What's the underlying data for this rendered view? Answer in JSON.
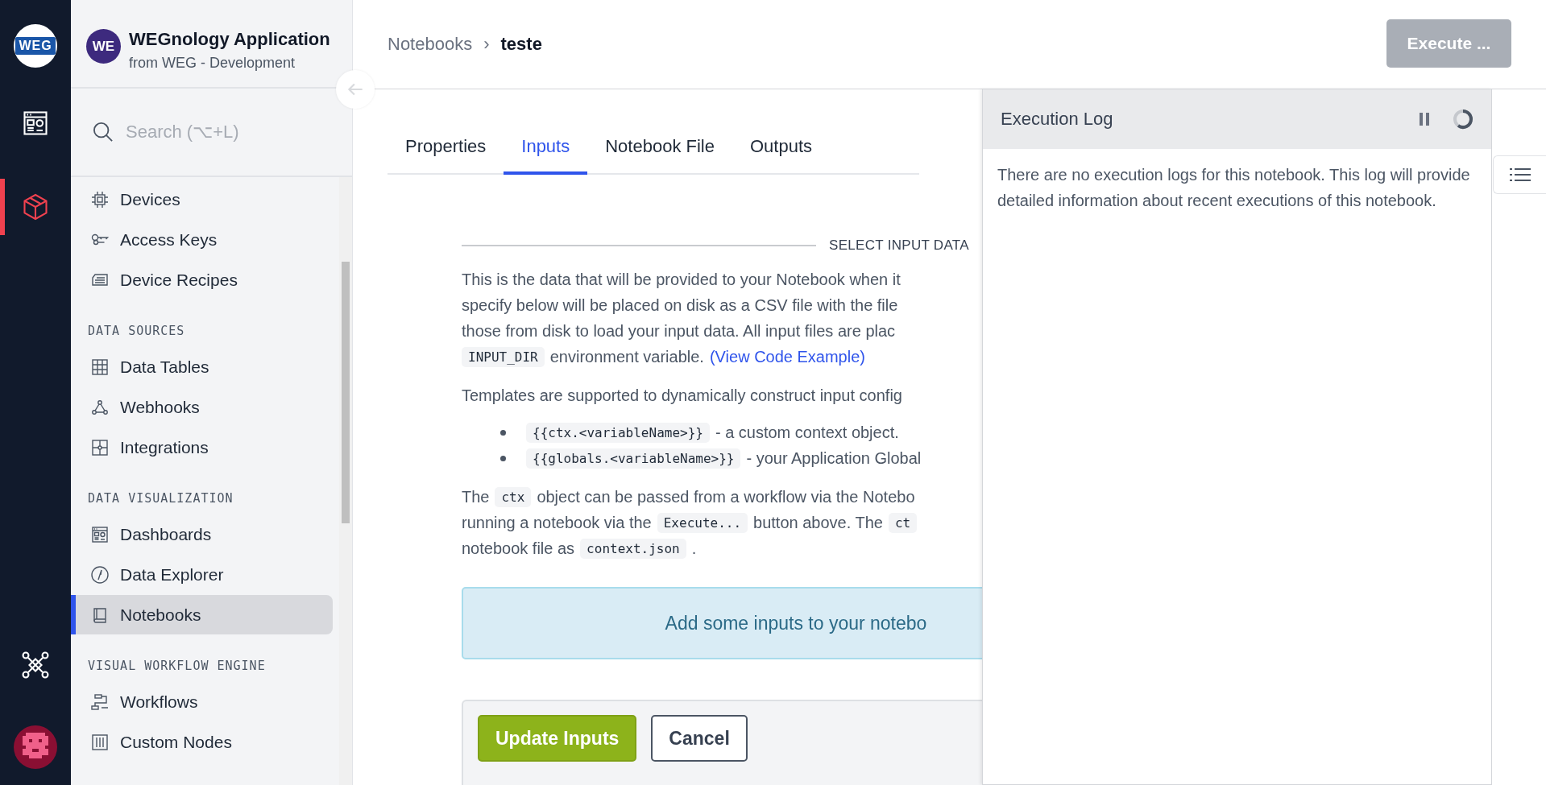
{
  "rail": {
    "logo": "WEG",
    "items": [
      {
        "kind": "dashboard",
        "selected": false
      },
      {
        "kind": "cube",
        "selected": true
      }
    ],
    "bottom_items": [
      {
        "kind": "network",
        "selected": false
      }
    ]
  },
  "app": {
    "avatar": "WE",
    "name": "WEGnology Application",
    "subtitle": "from WEG - Development"
  },
  "search": {
    "placeholder": "Search (⌥+L)"
  },
  "nav": [
    {
      "items": [
        {
          "label": "Devices",
          "kind": "chip",
          "selected": false
        },
        {
          "label": "Access Keys",
          "kind": "keys",
          "selected": false
        },
        {
          "label": "Device Recipes",
          "kind": "recipe",
          "selected": false
        }
      ]
    },
    {
      "title": "DATA SOURCES",
      "items": [
        {
          "label": "Data Tables",
          "kind": "grid",
          "selected": false
        },
        {
          "label": "Webhooks",
          "kind": "webhook",
          "selected": false
        },
        {
          "label": "Integrations",
          "kind": "puzzle",
          "selected": false
        }
      ]
    },
    {
      "title": "DATA VISUALIZATION",
      "items": [
        {
          "label": "Dashboards",
          "kind": "dashboard",
          "selected": false
        },
        {
          "label": "Data Explorer",
          "kind": "compass",
          "selected": false
        },
        {
          "label": "Notebooks",
          "kind": "book",
          "selected": true
        }
      ]
    },
    {
      "title": "VISUAL WORKFLOW ENGINE",
      "items": [
        {
          "label": "Workflows",
          "kind": "workflow",
          "selected": false
        },
        {
          "label": "Custom Nodes",
          "kind": "sliders",
          "selected": false
        }
      ]
    }
  ],
  "breadcrumb": {
    "parent": "Notebooks",
    "separator": "›",
    "current": "teste"
  },
  "execute_button": {
    "label": "Execute ...",
    "disabled": true
  },
  "tabs": [
    {
      "label": "Properties",
      "selected": false
    },
    {
      "label": "Inputs",
      "selected": true
    },
    {
      "label": "Notebook File",
      "selected": false
    },
    {
      "label": "Outputs",
      "selected": false
    }
  ],
  "section_title": "SELECT INPUT DATA",
  "paragraphs": [
    {
      "lines": [
        [
          {
            "kind": "text",
            "text": "This is the data that will be provided to your Notebook when it"
          }
        ],
        [
          {
            "kind": "text",
            "text": "specify below will be placed on disk as a CSV file with the file"
          }
        ],
        [
          {
            "kind": "text",
            "text": "those from disk to load your input data. All input files are plac"
          }
        ],
        [
          {
            "kind": "code",
            "text": "INPUT_DIR"
          },
          {
            "kind": "text",
            "text": "environment variable."
          },
          {
            "kind": "link",
            "text": "(View Code Example)"
          }
        ]
      ]
    },
    {
      "lines": [
        [
          {
            "kind": "text",
            "text": "Templates are supported to dynamically construct input config"
          }
        ]
      ]
    },
    {
      "bullets": [
        [
          {
            "kind": "code",
            "text": "{{ctx.<variableName>}}"
          },
          {
            "kind": "text",
            "text": "- a custom context object."
          }
        ],
        [
          {
            "kind": "code",
            "text": "{{globals.<variableName>}}"
          },
          {
            "kind": "text",
            "text": "- your Application Global"
          }
        ]
      ]
    },
    {
      "lines": [
        [
          {
            "kind": "text",
            "text": "The"
          },
          {
            "kind": "code",
            "text": "ctx"
          },
          {
            "kind": "text",
            "text": "object can be passed from a workflow via the Notebo"
          }
        ],
        [
          {
            "kind": "text",
            "text": "running a notebook via the"
          },
          {
            "kind": "code",
            "text": "Execute..."
          },
          {
            "kind": "text",
            "text": "button above. The"
          },
          {
            "kind": "code",
            "text": "ct"
          }
        ],
        [
          {
            "kind": "text",
            "text": "notebook file as"
          },
          {
            "kind": "code",
            "text": "context.json"
          },
          {
            "kind": "text",
            "text": "."
          }
        ]
      ]
    }
  ],
  "callout": "Add some inputs to your notebo",
  "buttons": [
    {
      "label": "Update Inputs",
      "kind": "primary"
    },
    {
      "label": "Cancel",
      "kind": "secondary"
    }
  ],
  "log": {
    "title": "Execution Log",
    "message": "There are no execution logs for this notebook. This log will provide detailed information about recent executions of this notebook."
  }
}
